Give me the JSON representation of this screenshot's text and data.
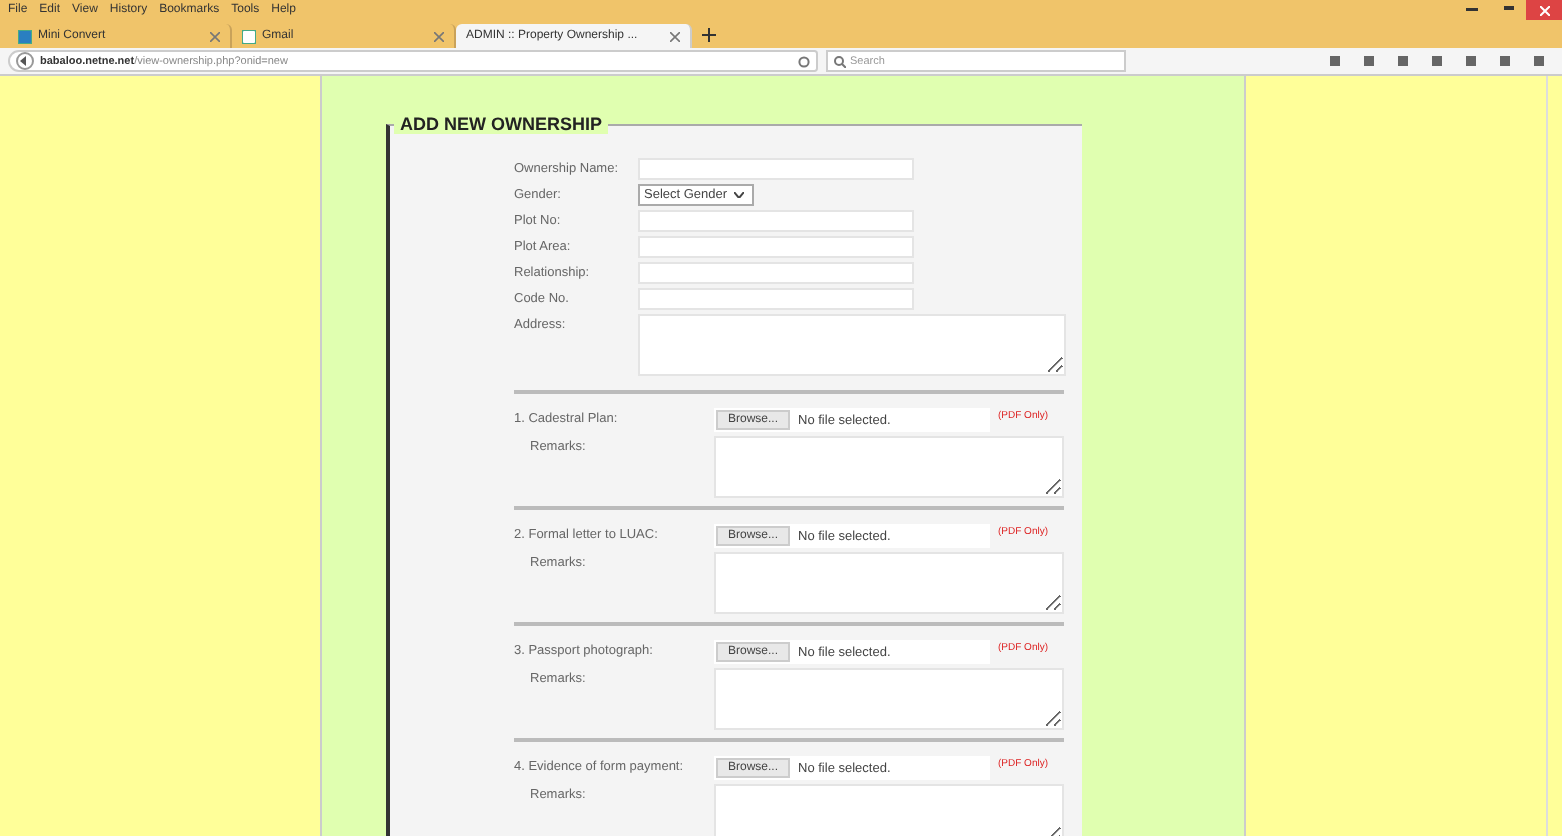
{
  "menu": [
    "File",
    "Edit",
    "View",
    "History",
    "Bookmarks",
    "Tools",
    "Help"
  ],
  "tabs": [
    {
      "label": "Mini Convert",
      "selected": false
    },
    {
      "label": "Gmail",
      "selected": false
    },
    {
      "label": "ADMIN :: Property Ownership ...",
      "selected": true
    }
  ],
  "address_bar": {
    "url_host": "babaloo.netne.net",
    "url_path": "/view-ownership.php?onid=new",
    "search_placeholder": "Search"
  },
  "form": {
    "legend": "ADD NEW OWNERSHIP",
    "fields": [
      {
        "label": "Ownership Name:",
        "kind": "text"
      },
      {
        "label": "Gender:",
        "kind": "select",
        "value": "Select Gender"
      },
      {
        "label": "Plot No:",
        "kind": "text"
      },
      {
        "label": "Plot Area:",
        "kind": "text"
      },
      {
        "label": "Relationship:",
        "kind": "text"
      },
      {
        "label": "Code No.",
        "kind": "text"
      },
      {
        "label": "Address:",
        "kind": "textarea"
      }
    ],
    "documents": [
      {
        "label": "1. Cadestral Plan:",
        "button": "Browse...",
        "file": "No file selected.",
        "note": "(PDF Only)",
        "remarks": "Remarks:"
      },
      {
        "label": "2. Formal letter to LUAC:",
        "button": "Browse...",
        "file": "No file selected.",
        "note": "(PDF Only)",
        "remarks": "Remarks:"
      },
      {
        "label": "3. Passport photograph:",
        "button": "Browse...",
        "file": "No file selected.",
        "note": "(PDF Only)",
        "remarks": "Remarks:"
      },
      {
        "label": "4. Evidence of form payment:",
        "button": "Browse...",
        "file": "No file selected.",
        "note": "(PDF Only)",
        "remarks": "Remarks:"
      }
    ]
  }
}
